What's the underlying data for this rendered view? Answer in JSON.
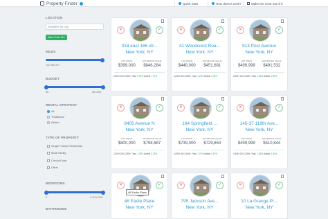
{
  "header": {
    "title": "Property Finder",
    "nav": [
      "Quick Start",
      "How does it work?",
      "Make the most out of it"
    ]
  },
  "sidebar": {
    "location_label": "LOCATION",
    "location_placeholder": "Explore by city",
    "location_chip": "New York, NY",
    "miles_label": "MILES",
    "miles_min": "150 MILES",
    "budget_label": "BUDGET",
    "budget_min": "$0",
    "budget_max": "$5.00M",
    "strategy_label": "RENTAL STRATEGY",
    "strategies": [
      "All",
      "Traditional",
      "Airbnb"
    ],
    "type_label": "TYPE OF PROPERTY",
    "types": [
      "Single Family Residential",
      "Multi Family",
      "Condo/Coop",
      "Other"
    ],
    "bedrooms_label": "BEDROOMS",
    "bed_min": "0",
    "bed_max": "5 ROOMS",
    "bathrooms_label": "BATHROOMS"
  },
  "card_labels": {
    "list_price": "LIST PRICE",
    "estimated_value": "ESTIMATED VALUE",
    "cash_on_cash": "CASH ON CASH:",
    "trad": "Trad.",
    "airbnb": "Airbnb"
  },
  "cards": [
    {
      "addr1": "318 east 166 str...",
      "addr2": "New York, NY",
      "list": "$399,000",
      "est": "$846,284",
      "trad": "3.19%",
      "airbnb": "7.73%"
    },
    {
      "addr1": "41 Woodcrest Roa...",
      "addr2": "New York, NY",
      "list": "$448,000",
      "est": "$451,681",
      "trad": "1.26%",
      "airbnb": "4.35%"
    },
    {
      "addr1": "913 Post Avenue",
      "addr2": "New York, NY",
      "list": "$499,999",
      "est": "$491,532",
      "trad": "1.48%",
      "airbnb": "4.30%"
    },
    {
      "addr1": "8405 Avenue N",
      "addr2": "New York, NY",
      "list": "$800,000",
      "est": "$798,687",
      "trad": "1.39%",
      "airbnb": "4.76%"
    },
    {
      "addr1": "164 Springfield ...",
      "addr2": "New York, NY",
      "list": "$739,000",
      "est": "$729,650",
      "trad": "1.37%",
      "airbnb": "4.57%"
    },
    {
      "addr1": "145-37 119th Ave...",
      "addr2": "New York, NY",
      "list": "$499,999",
      "est": "$510,844",
      "trad": "1.48%",
      "airbnb": "4.40%"
    },
    {
      "addr1": "46 Eadie Place",
      "addr2": "New York, NY",
      "tag": "46 Eadie Place"
    },
    {
      "addr1": "795 Jackson Ave...",
      "addr2": "New York, NY"
    },
    {
      "addr1": "10 La Grange Pl...",
      "addr2": "New York, NY"
    }
  ],
  "colors": {
    "accent_blue": "#2f9bd6",
    "slider_blue": "#2f6fd0",
    "green": "#2fae66",
    "red": "#e0605a"
  }
}
